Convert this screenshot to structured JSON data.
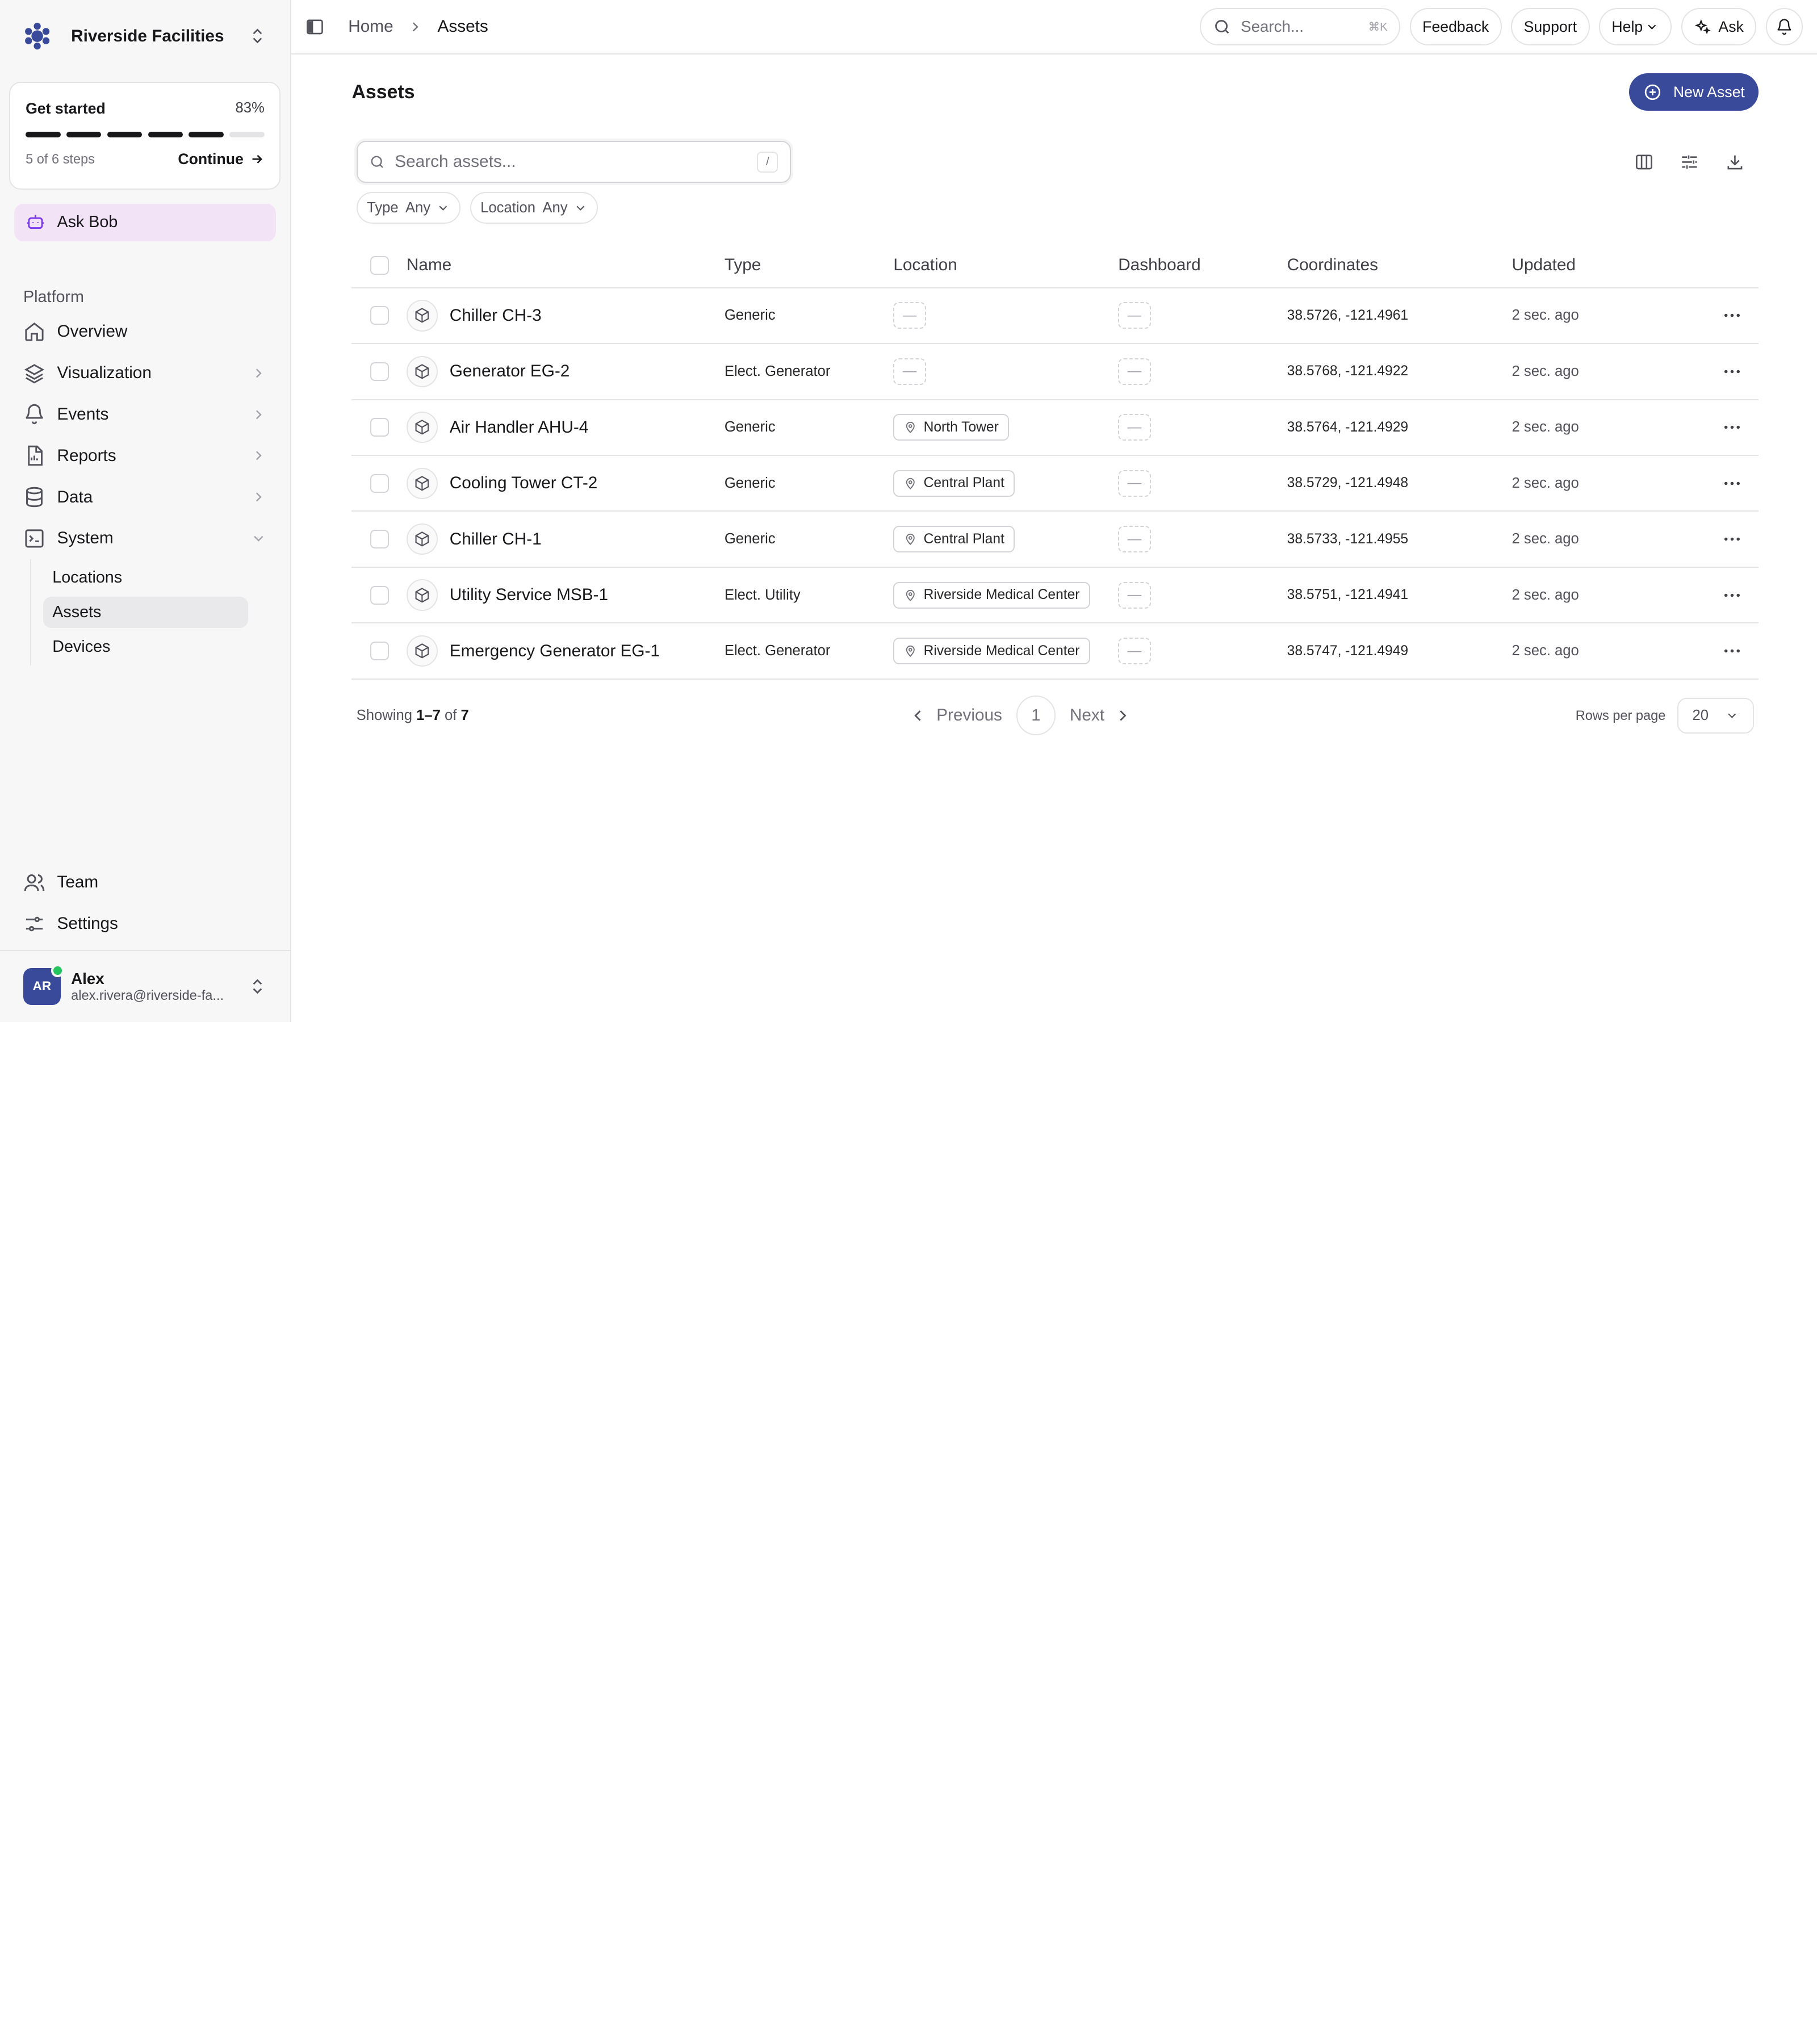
{
  "org": {
    "name": "Riverside Facilities",
    "brand_color": "#3a4a9b"
  },
  "get_started": {
    "title": "Get started",
    "percent": "83%",
    "steps": "5 of 6 steps",
    "continue": "Continue",
    "completed": 5,
    "total": 6
  },
  "ask_bob": {
    "label": "Ask Bob"
  },
  "platform": {
    "label": "Platform",
    "items": [
      {
        "label": "Overview",
        "icon": "home-icon"
      },
      {
        "label": "Visualization",
        "icon": "layers-icon"
      },
      {
        "label": "Events",
        "icon": "bell-icon"
      },
      {
        "label": "Reports",
        "icon": "report-icon"
      },
      {
        "label": "Data",
        "icon": "database-icon"
      },
      {
        "label": "System",
        "icon": "terminal-icon"
      }
    ],
    "system_sub": [
      "Locations",
      "Assets",
      "Devices"
    ]
  },
  "bottom_nav": [
    {
      "label": "Team",
      "icon": "users-icon"
    },
    {
      "label": "Settings",
      "icon": "sliders-icon"
    }
  ],
  "user": {
    "initials": "AR",
    "name": "Alex",
    "email": "alex.rivera@riverside-fa..."
  },
  "breadcrumb": {
    "home": "Home",
    "current": "Assets"
  },
  "topbar": {
    "search_placeholder": "Search...",
    "search_kbd": "⌘K",
    "feedback": "Feedback",
    "support": "Support",
    "help": "Help",
    "ask": "Ask"
  },
  "page": {
    "title": "Assets",
    "new_button": "New Asset"
  },
  "asset_search": {
    "placeholder": "Search assets...",
    "kbd": "/"
  },
  "filters": [
    {
      "label": "Type",
      "value": "Any"
    },
    {
      "label": "Location",
      "value": "Any"
    }
  ],
  "table": {
    "columns": [
      "Name",
      "Type",
      "Location",
      "Dashboard",
      "Coordinates",
      "Updated"
    ],
    "rows": [
      {
        "name": "Chiller CH-3",
        "type": "Generic",
        "location": "",
        "coords": "38.5726, -121.4961",
        "updated": "2 sec. ago"
      },
      {
        "name": "Generator EG-2",
        "type": "Elect. Generator",
        "location": "",
        "coords": "38.5768, -121.4922",
        "updated": "2 sec. ago"
      },
      {
        "name": "Air Handler AHU-4",
        "type": "Generic",
        "location": "North Tower",
        "coords": "38.5764, -121.4929",
        "updated": "2 sec. ago"
      },
      {
        "name": "Cooling Tower CT-2",
        "type": "Generic",
        "location": "Central Plant",
        "coords": "38.5729, -121.4948",
        "updated": "2 sec. ago"
      },
      {
        "name": "Chiller CH-1",
        "type": "Generic",
        "location": "Central Plant",
        "coords": "38.5733, -121.4955",
        "updated": "2 sec. ago"
      },
      {
        "name": "Utility Service MSB-1",
        "type": "Elect. Utility",
        "location": "Riverside Medical Center",
        "coords": "38.5751, -121.4941",
        "updated": "2 sec. ago"
      },
      {
        "name": "Emergency Generator EG-1",
        "type": "Elect. Generator",
        "location": "Riverside Medical Center",
        "coords": "38.5747, -121.4949",
        "updated": "2 sec. ago"
      }
    ],
    "empty_marker": "—"
  },
  "pagination": {
    "showing_prefix": "Showing",
    "range": "1–7",
    "of": "of",
    "total": "7",
    "previous": "Previous",
    "page": "1",
    "next": "Next",
    "rows_per_page_label": "Rows per page",
    "rows_per_page": "20"
  }
}
